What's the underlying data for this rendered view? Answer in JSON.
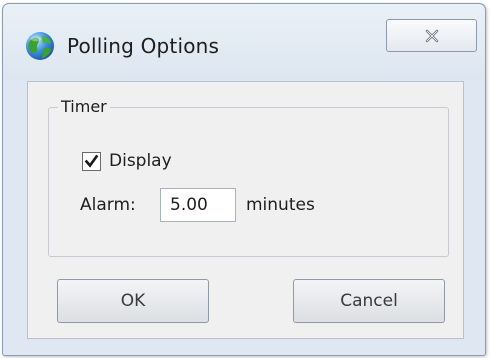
{
  "window": {
    "title": "Polling Options",
    "icon": "globe-icon",
    "close_icon": "close-icon"
  },
  "timer": {
    "group_label": "Timer",
    "display_label": "Display",
    "display_checked": true,
    "alarm_label": "Alarm:",
    "alarm_value": "5.00",
    "alarm_unit": "minutes"
  },
  "buttons": {
    "ok_label": "OK",
    "cancel_label": "Cancel"
  },
  "colors": {
    "frame": "#dfe8f2",
    "client": "#f0f0f0",
    "globe_green": "#3aa12f",
    "globe_blue": "#2a6fc9"
  }
}
